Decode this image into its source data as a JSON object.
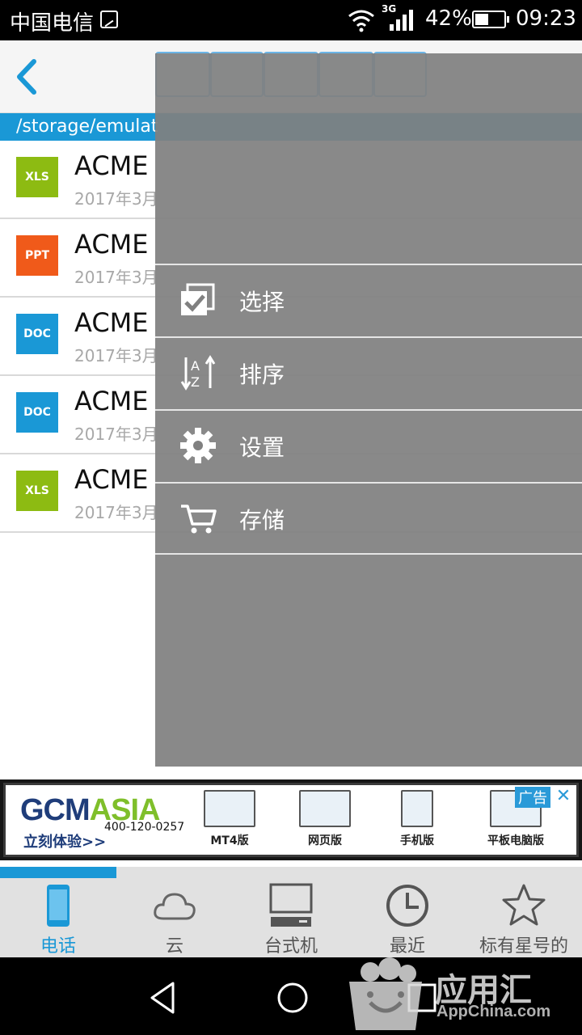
{
  "status_bar": {
    "carrier": "中国电信",
    "network": "3G",
    "battery": "42%",
    "battery_level": 0.42,
    "time": "09:23"
  },
  "path_bar": {
    "path": "/storage/emulat"
  },
  "files": [
    {
      "type": "XLS",
      "color": "#8dbb12",
      "name": "ACME",
      "date": "2017年3月"
    },
    {
      "type": "PPT",
      "color": "#f05a1a",
      "name": "ACME",
      "date": "2017年3月"
    },
    {
      "type": "DOC",
      "color": "#1a98d6",
      "name": "ACME",
      "date": "2017年3月"
    },
    {
      "type": "DOC",
      "color": "#1a98d6",
      "name": "ACME",
      "date": "2017年3月"
    },
    {
      "type": "XLS",
      "color": "#8dbb12",
      "name": "ACME",
      "date": "2017年3月"
    }
  ],
  "menu": {
    "items": [
      {
        "label": "选择",
        "icon": "checkbox-icon"
      },
      {
        "label": "排序",
        "icon": "sort-az-icon"
      },
      {
        "label": "设置",
        "icon": "gear-icon"
      },
      {
        "label": "存储",
        "icon": "cart-icon"
      }
    ]
  },
  "ad": {
    "logo_a": "GCM",
    "logo_b": "ASIA",
    "tagline": "立刻体验>>",
    "phone": "400-120-0257",
    "products": [
      "MT4版",
      "网页版",
      "手机版",
      "平板电脑版"
    ],
    "tag": "广告",
    "close": "✕"
  },
  "bottom_nav": {
    "progress": 0.2,
    "items": [
      {
        "label": "电话",
        "icon": "phone-icon",
        "active": true
      },
      {
        "label": "云",
        "icon": "cloud-icon",
        "active": false
      },
      {
        "label": "台式机",
        "icon": "desktop-icon",
        "active": false
      },
      {
        "label": "最近",
        "icon": "clock-icon",
        "active": false
      },
      {
        "label": "标有星号的",
        "icon": "star-icon",
        "active": false
      }
    ]
  },
  "watermark": {
    "title": "应用汇",
    "subtitle": "AppChina.com"
  },
  "colors": {
    "accent": "#1a98d6",
    "menu_overlay": "#808080"
  }
}
